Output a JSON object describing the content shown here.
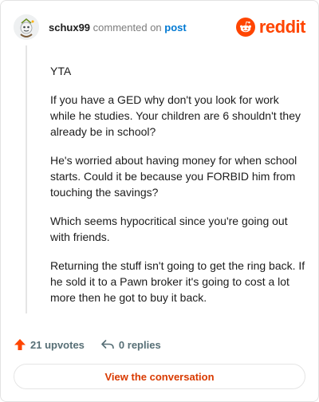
{
  "header": {
    "username": "schux99",
    "action_text": "commented on",
    "post_link": "post",
    "brand_name": "reddit"
  },
  "comment": {
    "paragraphs": [
      "YTA",
      "If you have a GED why don't you look for work while he studies. Your children are 6 shouldn't they already be in school?",
      "He's worried about having money for when school starts. Could it be because you FORBID him from touching the savings?",
      "Which seems hypocritical since you're going out with friends.",
      "Returning the stuff isn't going to get the ring back. If he sold it to a Pawn broker it's going to cost a lot more then he got to buy it back."
    ]
  },
  "footer": {
    "upvotes": "21 upvotes",
    "replies": "0 replies",
    "upvote_icon": "upvote-arrow-icon",
    "reply_icon": "reply-arrow-icon"
  },
  "cta": {
    "label": "View the conversation"
  },
  "colors": {
    "brand": "#ff4500",
    "link": "#0079d3",
    "cta_text": "#d93a00",
    "muted": "#576f76"
  }
}
